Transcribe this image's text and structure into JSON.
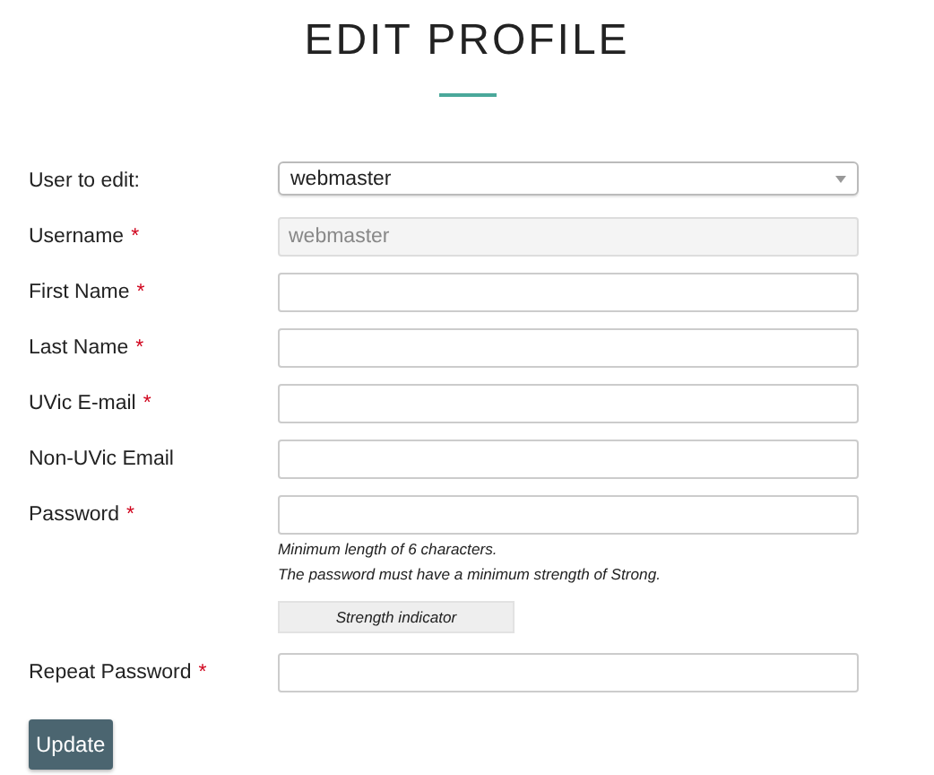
{
  "title": "EDIT PROFILE",
  "fields": [
    {
      "kind": "select",
      "label": "User to edit:",
      "value": "webmaster",
      "disabled": false
    },
    {
      "kind": "text",
      "label": "Username",
      "required_mark": "*",
      "value": "webmaster",
      "disabled": true
    },
    {
      "kind": "text",
      "label": "First Name",
      "required_mark": "*",
      "disabled": false
    },
    {
      "kind": "text",
      "label": "Last Name",
      "required_mark": "*",
      "disabled": false
    },
    {
      "kind": "text",
      "label": "UVic E-mail",
      "required_mark": "*",
      "disabled": false
    },
    {
      "kind": "text",
      "label": "Non-UVic Email",
      "disabled": false
    },
    {
      "kind": "password",
      "label": "Password",
      "required_mark": "*",
      "disabled": false,
      "hints": [
        "Minimum length of 6 characters.",
        "The password must have a minimum strength of Strong."
      ],
      "strength_indicator": "Strength indicator"
    },
    {
      "kind": "password",
      "label": "Repeat Password",
      "required_mark": "*",
      "disabled": false
    }
  ],
  "submit_button": "Update"
}
